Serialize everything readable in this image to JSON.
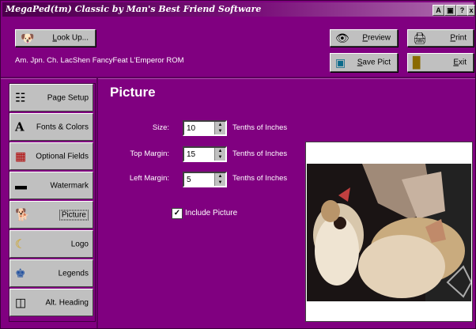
{
  "window": {
    "title": "MegaPed(tm) Classic by Man's Best Friend Software"
  },
  "title_buttons": [
    "A",
    "▣",
    "?",
    "x"
  ],
  "top_buttons": {
    "lookup": "Look Up...",
    "preview": "Preview",
    "print": "Print",
    "save_pict": "Save Pict",
    "exit": "Exit"
  },
  "dog_name": "Am. Jpn. Ch. LacShen FancyFeat L'Emperor ROM",
  "sidebar": {
    "items": [
      {
        "label": "Page Setup",
        "icon": "page-setup-icon"
      },
      {
        "label": "Fonts & Colors",
        "icon": "font-icon"
      },
      {
        "label": "Optional Fields",
        "icon": "optional-fields-icon"
      },
      {
        "label": "Watermark",
        "icon": "watermark-icon"
      },
      {
        "label": "Picture",
        "icon": "picture-icon"
      },
      {
        "label": "Logo",
        "icon": "logo-icon"
      },
      {
        "label": "Legends",
        "icon": "legends-icon"
      },
      {
        "label": "Alt. Heading",
        "icon": "alt-heading-icon"
      }
    ],
    "active": "Picture"
  },
  "panel": {
    "heading": "Picture",
    "fields": [
      {
        "label": "Size:",
        "value": "10",
        "unit": "Tenths of Inches"
      },
      {
        "label": "Top Margin:",
        "value": "15",
        "unit": "Tenths of Inches"
      },
      {
        "label": "Left Margin:",
        "value": "5",
        "unit": "Tenths of Inches"
      }
    ],
    "include_picture": {
      "label": "Include Picture",
      "checked": true
    }
  },
  "colors": {
    "background": "#800080",
    "button_face": "#c0c0c0"
  }
}
